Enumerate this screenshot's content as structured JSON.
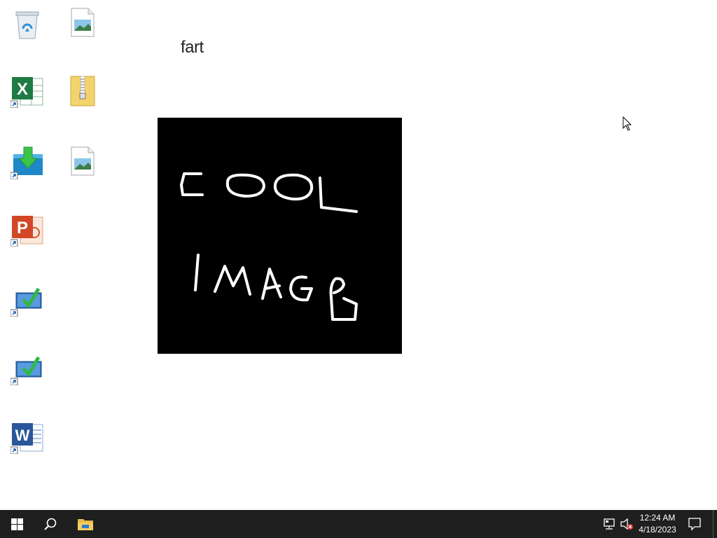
{
  "desktop": {
    "wallpaper_text": "fart",
    "image_text_line1": "COOL",
    "image_text_line2": "IMAGE",
    "icons": [
      {
        "name": "recycle-bin-icon"
      },
      {
        "name": "image-file-icon"
      },
      {
        "name": "excel-shortcut-icon"
      },
      {
        "name": "zip-folder-icon"
      },
      {
        "name": "download-shortcut-icon"
      },
      {
        "name": "image-file-icon"
      },
      {
        "name": "powerpoint-shortcut-icon"
      },
      {
        "name": "remote-desktop-shortcut-icon"
      },
      {
        "name": "remote-desktop-shortcut-icon"
      },
      {
        "name": "word-shortcut-icon"
      }
    ]
  },
  "taskbar": {
    "start_icon": "windows-logo-icon",
    "search_icon": "search-icon",
    "pinned_apps": [
      {
        "name": "file-explorer-icon"
      }
    ],
    "tray": {
      "network_icon": "network-icon",
      "volume_icon": "volume-muted-icon",
      "time": "12:24 AM",
      "date": "4/18/2023",
      "notification_icon": "action-center-icon"
    }
  },
  "colors": {
    "taskbar_bg": "#1f1f1f",
    "desktop_bg": "#ffffff",
    "image_bg": "#000000",
    "accent_blue": "#2b7cd3"
  }
}
